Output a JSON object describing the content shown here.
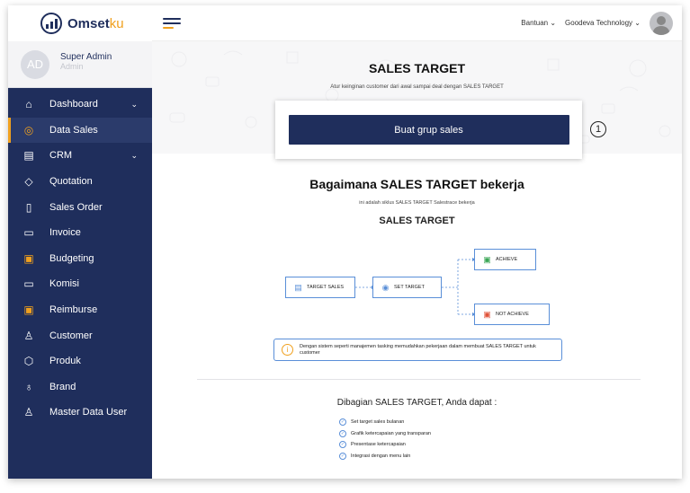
{
  "app": {
    "brand_main": "Omset",
    "brand_accent": "ku"
  },
  "profile": {
    "initials": "AD",
    "name": "Super Admin",
    "role": "Admin"
  },
  "sidebar": {
    "items": [
      {
        "label": "Dashboard",
        "icon": "home-icon",
        "glyph": "⌂",
        "chevron": "⌄"
      },
      {
        "label": "Data Sales",
        "icon": "target-icon",
        "glyph": "◎",
        "active": true
      },
      {
        "label": "CRM",
        "icon": "crm-icon",
        "glyph": "▤",
        "chevron": "⌄"
      },
      {
        "label": "Quotation",
        "icon": "tag-icon",
        "glyph": "◇"
      },
      {
        "label": "Sales Order",
        "icon": "document-icon",
        "glyph": "▯"
      },
      {
        "label": "Invoice",
        "icon": "invoice-icon",
        "glyph": "▭"
      },
      {
        "label": "Budgeting",
        "icon": "budget-icon",
        "glyph": "▣"
      },
      {
        "label": "Komisi",
        "icon": "commission-icon",
        "glyph": "▭"
      },
      {
        "label": "Reimburse",
        "icon": "reimburse-icon",
        "glyph": "▣"
      },
      {
        "label": "Customer",
        "icon": "customer-icon",
        "glyph": "♙"
      },
      {
        "label": "Produk",
        "icon": "box-icon",
        "glyph": "⬡"
      },
      {
        "label": "Brand",
        "icon": "brand-icon",
        "glyph": "♁"
      },
      {
        "label": "Master Data User",
        "icon": "user-settings-icon",
        "glyph": "♙"
      }
    ]
  },
  "topbar": {
    "help": "Bantuan",
    "company": "Goodeva Technology",
    "chevron": "⌄"
  },
  "hero": {
    "title": "SALES TARGET",
    "subtitle": "Atur keinginan customer dari awal sampai deal dengan SALES TARGET",
    "cta": "Buat grup sales",
    "step": "1"
  },
  "how": {
    "title": "Bagaimana SALES TARGET bekerja",
    "subtitle": "ini adalah siklus SALES TARGET Salestrace bekerja",
    "flow_title": "SALES TARGET",
    "nodes": {
      "target_sales": "TARGET SALES",
      "set_target": "SET TARGET",
      "achieve": "ACHIEVE",
      "not_achieve": "NOT ACHIEVE"
    },
    "info": "Dengan sistem seperti manajemen tasking memudahkan pekerjaan dalam membuat SALES TARGET untuk customer"
  },
  "benefits": {
    "title": "Dibagian SALES TARGET, Anda dapat :",
    "items": [
      "Set target sales bulanan",
      "Grafik ketercapaian yang transparan",
      "Presentase ketercapaian",
      "Integrasi dengan menu lain"
    ]
  },
  "colors": {
    "navy": "#1f2e5c",
    "accent": "#f0a01e",
    "flow_blue": "#5a8fd8",
    "achieve_green": "#3aa655",
    "not_achieve_red": "#e0533a"
  }
}
